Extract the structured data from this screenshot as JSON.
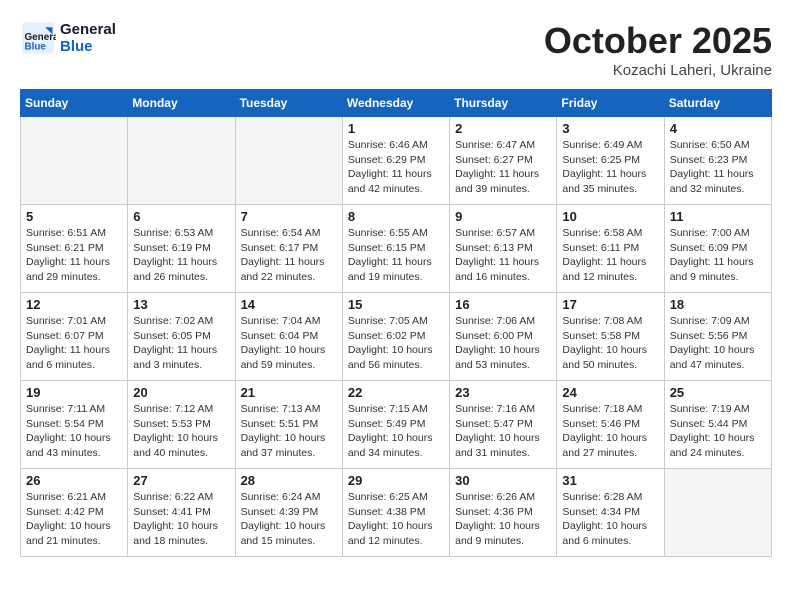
{
  "header": {
    "logo_line1": "General",
    "logo_line2": "Blue",
    "month": "October 2025",
    "location": "Kozachi Laheri, Ukraine"
  },
  "weekdays": [
    "Sunday",
    "Monday",
    "Tuesday",
    "Wednesday",
    "Thursday",
    "Friday",
    "Saturday"
  ],
  "weeks": [
    [
      {
        "day": "",
        "info": ""
      },
      {
        "day": "",
        "info": ""
      },
      {
        "day": "",
        "info": ""
      },
      {
        "day": "1",
        "info": "Sunrise: 6:46 AM\nSunset: 6:29 PM\nDaylight: 11 hours\nand 42 minutes."
      },
      {
        "day": "2",
        "info": "Sunrise: 6:47 AM\nSunset: 6:27 PM\nDaylight: 11 hours\nand 39 minutes."
      },
      {
        "day": "3",
        "info": "Sunrise: 6:49 AM\nSunset: 6:25 PM\nDaylight: 11 hours\nand 35 minutes."
      },
      {
        "day": "4",
        "info": "Sunrise: 6:50 AM\nSunset: 6:23 PM\nDaylight: 11 hours\nand 32 minutes."
      }
    ],
    [
      {
        "day": "5",
        "info": "Sunrise: 6:51 AM\nSunset: 6:21 PM\nDaylight: 11 hours\nand 29 minutes."
      },
      {
        "day": "6",
        "info": "Sunrise: 6:53 AM\nSunset: 6:19 PM\nDaylight: 11 hours\nand 26 minutes."
      },
      {
        "day": "7",
        "info": "Sunrise: 6:54 AM\nSunset: 6:17 PM\nDaylight: 11 hours\nand 22 minutes."
      },
      {
        "day": "8",
        "info": "Sunrise: 6:55 AM\nSunset: 6:15 PM\nDaylight: 11 hours\nand 19 minutes."
      },
      {
        "day": "9",
        "info": "Sunrise: 6:57 AM\nSunset: 6:13 PM\nDaylight: 11 hours\nand 16 minutes."
      },
      {
        "day": "10",
        "info": "Sunrise: 6:58 AM\nSunset: 6:11 PM\nDaylight: 11 hours\nand 12 minutes."
      },
      {
        "day": "11",
        "info": "Sunrise: 7:00 AM\nSunset: 6:09 PM\nDaylight: 11 hours\nand 9 minutes."
      }
    ],
    [
      {
        "day": "12",
        "info": "Sunrise: 7:01 AM\nSunset: 6:07 PM\nDaylight: 11 hours\nand 6 minutes."
      },
      {
        "day": "13",
        "info": "Sunrise: 7:02 AM\nSunset: 6:05 PM\nDaylight: 11 hours\nand 3 minutes."
      },
      {
        "day": "14",
        "info": "Sunrise: 7:04 AM\nSunset: 6:04 PM\nDaylight: 10 hours\nand 59 minutes."
      },
      {
        "day": "15",
        "info": "Sunrise: 7:05 AM\nSunset: 6:02 PM\nDaylight: 10 hours\nand 56 minutes."
      },
      {
        "day": "16",
        "info": "Sunrise: 7:06 AM\nSunset: 6:00 PM\nDaylight: 10 hours\nand 53 minutes."
      },
      {
        "day": "17",
        "info": "Sunrise: 7:08 AM\nSunset: 5:58 PM\nDaylight: 10 hours\nand 50 minutes."
      },
      {
        "day": "18",
        "info": "Sunrise: 7:09 AM\nSunset: 5:56 PM\nDaylight: 10 hours\nand 47 minutes."
      }
    ],
    [
      {
        "day": "19",
        "info": "Sunrise: 7:11 AM\nSunset: 5:54 PM\nDaylight: 10 hours\nand 43 minutes."
      },
      {
        "day": "20",
        "info": "Sunrise: 7:12 AM\nSunset: 5:53 PM\nDaylight: 10 hours\nand 40 minutes."
      },
      {
        "day": "21",
        "info": "Sunrise: 7:13 AM\nSunset: 5:51 PM\nDaylight: 10 hours\nand 37 minutes."
      },
      {
        "day": "22",
        "info": "Sunrise: 7:15 AM\nSunset: 5:49 PM\nDaylight: 10 hours\nand 34 minutes."
      },
      {
        "day": "23",
        "info": "Sunrise: 7:16 AM\nSunset: 5:47 PM\nDaylight: 10 hours\nand 31 minutes."
      },
      {
        "day": "24",
        "info": "Sunrise: 7:18 AM\nSunset: 5:46 PM\nDaylight: 10 hours\nand 27 minutes."
      },
      {
        "day": "25",
        "info": "Sunrise: 7:19 AM\nSunset: 5:44 PM\nDaylight: 10 hours\nand 24 minutes."
      }
    ],
    [
      {
        "day": "26",
        "info": "Sunrise: 6:21 AM\nSunset: 4:42 PM\nDaylight: 10 hours\nand 21 minutes."
      },
      {
        "day": "27",
        "info": "Sunrise: 6:22 AM\nSunset: 4:41 PM\nDaylight: 10 hours\nand 18 minutes."
      },
      {
        "day": "28",
        "info": "Sunrise: 6:24 AM\nSunset: 4:39 PM\nDaylight: 10 hours\nand 15 minutes."
      },
      {
        "day": "29",
        "info": "Sunrise: 6:25 AM\nSunset: 4:38 PM\nDaylight: 10 hours\nand 12 minutes."
      },
      {
        "day": "30",
        "info": "Sunrise: 6:26 AM\nSunset: 4:36 PM\nDaylight: 10 hours\nand 9 minutes."
      },
      {
        "day": "31",
        "info": "Sunrise: 6:28 AM\nSunset: 4:34 PM\nDaylight: 10 hours\nand 6 minutes."
      },
      {
        "day": "",
        "info": ""
      }
    ]
  ]
}
